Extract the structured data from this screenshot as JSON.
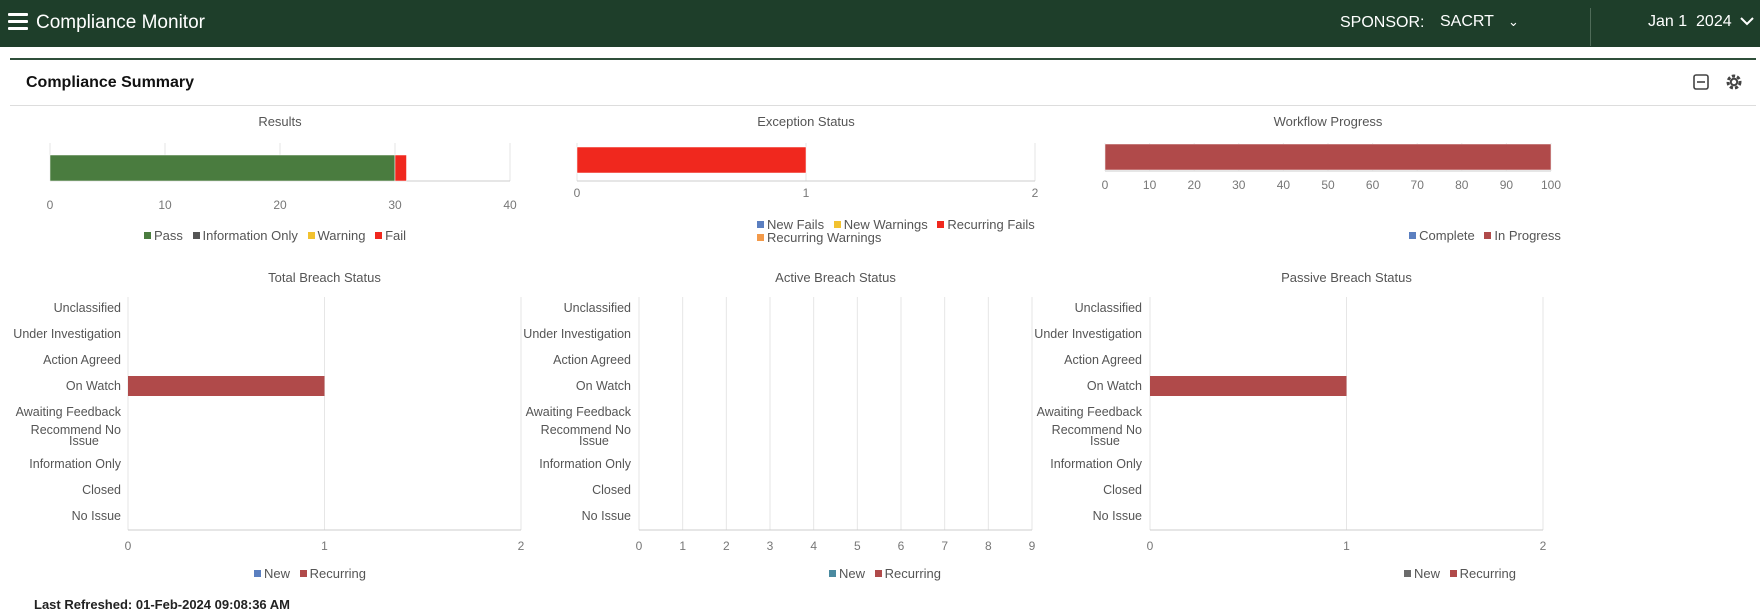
{
  "header": {
    "app_title": "Compliance Monitor",
    "sponsor_label": "SPONSOR:",
    "sponsor_value": "SACRT",
    "date_value": "Jan 1  2024",
    "icons": {
      "menu": "hamburger-menu-icon",
      "chevron": "chevron-down-icon"
    }
  },
  "panel": {
    "title": "Compliance Summary",
    "icons": {
      "collapse": "collapse-icon",
      "settings": "gear-icon"
    }
  },
  "colors": {
    "topbar": "#1e3e2a",
    "pass": "#4a7c3f",
    "information_only": "#555555",
    "warning": "#f2c230",
    "fail": "#f0281e",
    "blue": "#5b7fc0",
    "orange": "#f39a4a",
    "recurring": "#b04a4a"
  },
  "footer": {
    "last_refreshed": "Last Refreshed: 01-Feb-2024 09:08:36 AM"
  },
  "chart_data": [
    {
      "id": "results",
      "type": "bar",
      "orientation": "horizontal",
      "stacked": true,
      "title": "Results",
      "xlim": [
        0,
        40
      ],
      "xticks": [
        "0",
        "10",
        "20",
        "30",
        "40"
      ],
      "series": [
        {
          "name": "Pass",
          "color": "#4a7c3f",
          "values": [
            30
          ]
        },
        {
          "name": "Information Only",
          "color": "#555555",
          "values": [
            0
          ]
        },
        {
          "name": "Warning",
          "color": "#f2c230",
          "values": [
            0
          ]
        },
        {
          "name": "Fail",
          "color": "#f0281e",
          "values": [
            1
          ]
        }
      ]
    },
    {
      "id": "exception",
      "type": "bar",
      "orientation": "horizontal",
      "stacked": true,
      "title": "Exception Status",
      "xlim": [
        0,
        2
      ],
      "xticks": [
        "0",
        "1",
        "2"
      ],
      "series": [
        {
          "name": "New Fails",
          "color": "#5b7fc0",
          "values": [
            0
          ]
        },
        {
          "name": "New Warnings",
          "color": "#f2c230",
          "values": [
            0
          ]
        },
        {
          "name": "Recurring Fails",
          "color": "#f0281e",
          "values": [
            1
          ]
        },
        {
          "name": "Recurring Warnings",
          "color": "#f39a4a",
          "values": [
            0
          ]
        }
      ]
    },
    {
      "id": "workflow",
      "type": "bar",
      "orientation": "horizontal",
      "stacked": true,
      "title": "Workflow Progress",
      "xlim": [
        0,
        100
      ],
      "xticks": [
        "0",
        "10",
        "20",
        "30",
        "40",
        "50",
        "60",
        "70",
        "80",
        "90",
        "100"
      ],
      "series": [
        {
          "name": "Complete",
          "color": "#5b7fc0",
          "values": [
            0
          ]
        },
        {
          "name": "In Progress",
          "color": "#b04a4a",
          "values": [
            100
          ]
        }
      ]
    },
    {
      "id": "total",
      "type": "bar",
      "orientation": "horizontal",
      "stacked": true,
      "title": "Total Breach Status",
      "categories": [
        "Unclassified",
        "Under Investigation",
        "Action Agreed",
        "On Watch",
        "Awaiting Feedback",
        "Recommend No Issue",
        "Information Only",
        "Closed",
        "No Issue"
      ],
      "xlim": [
        0,
        2
      ],
      "xticks": [
        "0",
        "1",
        "2"
      ],
      "series": [
        {
          "name": "New",
          "color": "#5b7fc0",
          "values": [
            0,
            0,
            0,
            0,
            0,
            0,
            0,
            0,
            0
          ]
        },
        {
          "name": "Recurring",
          "color": "#b04a4a",
          "values": [
            0,
            0,
            0,
            1,
            0,
            0,
            0,
            0,
            0
          ]
        }
      ]
    },
    {
      "id": "active",
      "type": "bar",
      "orientation": "horizontal",
      "stacked": true,
      "title": "Active Breach Status",
      "categories": [
        "Unclassified",
        "Under Investigation",
        "Action Agreed",
        "On Watch",
        "Awaiting Feedback",
        "Recommend No Issue",
        "Information Only",
        "Closed",
        "No Issue"
      ],
      "xlim": [
        0,
        9
      ],
      "xticks": [
        "0",
        "1",
        "2",
        "3",
        "4",
        "5",
        "6",
        "7",
        "8",
        "9"
      ],
      "series": [
        {
          "name": "New",
          "color": "#4a8aa0",
          "values": [
            0,
            0,
            0,
            0,
            0,
            0,
            0,
            0,
            0
          ]
        },
        {
          "name": "Recurring",
          "color": "#b04a4a",
          "values": [
            0,
            0,
            0,
            0,
            0,
            0,
            0,
            0,
            0
          ]
        }
      ]
    },
    {
      "id": "passive",
      "type": "bar",
      "orientation": "horizontal",
      "stacked": true,
      "title": "Passive Breach Status",
      "categories": [
        "Unclassified",
        "Under Investigation",
        "Action Agreed",
        "On Watch",
        "Awaiting Feedback",
        "Recommend No Issue",
        "Information Only",
        "Closed",
        "No Issue"
      ],
      "xlim": [
        0,
        2
      ],
      "xticks": [
        "0",
        "1",
        "2"
      ],
      "series": [
        {
          "name": "New",
          "color": "#6b6b6b",
          "values": [
            0,
            0,
            0,
            0,
            0,
            0,
            0,
            0,
            0
          ]
        },
        {
          "name": "Recurring",
          "color": "#b04a4a",
          "values": [
            0,
            0,
            0,
            1,
            0,
            0,
            0,
            0,
            0
          ]
        }
      ]
    }
  ]
}
